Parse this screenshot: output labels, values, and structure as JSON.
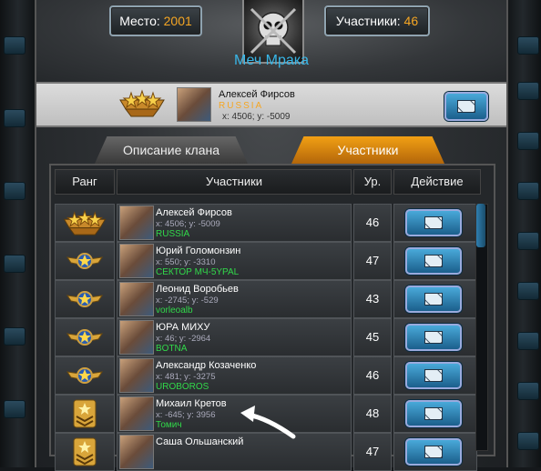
{
  "header": {
    "place_label": "Место:",
    "place_value": "2001",
    "members_label": "Участники:",
    "members_value": "46",
    "clan_name": "Меч Мрака"
  },
  "leader": {
    "name": "Алексей Фирсов",
    "country": "RUSSIA",
    "coords": "x: 4506; y: -5009"
  },
  "tabs": {
    "description": "Описание клана",
    "members": "Участники"
  },
  "table": {
    "headers": [
      "Ранг",
      "Участники",
      "Ур.",
      "Действие"
    ],
    "rows": [
      {
        "name": "Алексей Фирсов",
        "coords": "x: 4506; y: -5009",
        "clan": "RUSSIA",
        "level": "46",
        "rank": "three-stars"
      },
      {
        "name": "Юрий Голомонзин",
        "coords": "x: 550; y: -3310",
        "clan": "СЕКТОР МЧ-5YPAL",
        "level": "47",
        "rank": "winged-star"
      },
      {
        "name": "Леонид Воробьев",
        "coords": "x: -2745; y: -529",
        "clan": "vorleoalb",
        "level": "43",
        "rank": "winged-star"
      },
      {
        "name": "ЮРА МИХУ",
        "coords": "x: 46; y: -2964",
        "clan": "BOTNA",
        "level": "45",
        "rank": "winged-star"
      },
      {
        "name": "Александр Козаченко",
        "coords": "x: 481; y: -3275",
        "clan": "UROBOROS",
        "level": "46",
        "rank": "winged-star"
      },
      {
        "name": "Михаил Кретов",
        "coords": "x: -645; y: 3956",
        "clan": "Томич",
        "level": "48",
        "rank": "sergeant"
      },
      {
        "name": "Саша Ольшанский",
        "coords": "",
        "clan": "",
        "level": "47",
        "rank": "sergeant"
      }
    ]
  },
  "colors": {
    "accent_orange": "#f5a623",
    "clan_name_blue": "#39b7e8",
    "clan_green": "#31d84a"
  }
}
